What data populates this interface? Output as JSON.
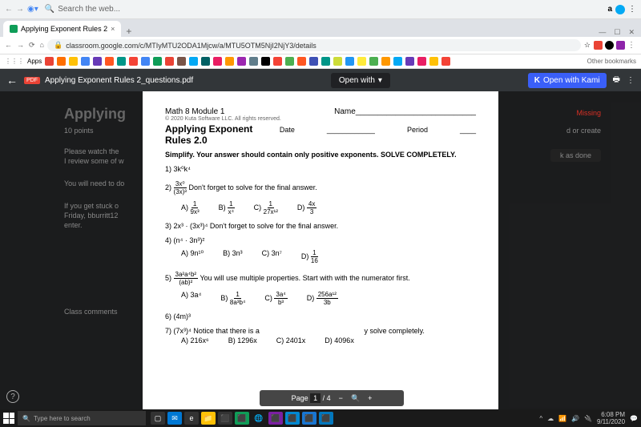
{
  "browser": {
    "search_placeholder": "Search the web...",
    "tab_title": "Applying Exponent Rules 2",
    "url": "classroom.google.com/c/MTIyMTU2ODA1Mjcw/a/MTU5OTM5NjI2NjY3/details",
    "apps_label": "Apps",
    "other_bookmarks": "Other bookmarks"
  },
  "pdf": {
    "filename": "Applying Exponent Rules 2_questions.pdf",
    "open_with": "Open with",
    "kami": "Open with Kami",
    "page_label": "Page",
    "page_current": "1",
    "page_total": "4"
  },
  "doc": {
    "module": "Math 8 Module 1",
    "copyright": "© 2020 Kuta Software LLC. All rights reserved.",
    "title": "Applying Exponent Rules 2.0",
    "name_label": "Name",
    "date_label": "Date",
    "period_label": "Period",
    "instructions": "Simplify. Your answer should contain only positive exponents. SOLVE COMPLETELY.",
    "problems": {
      "p1": "1) 3k⁰k⁴",
      "p2_label": "2)",
      "p2_note": "Don't forget to solve for the final answer.",
      "p2a": "A)",
      "p2b": "B)",
      "p2c": "C)",
      "p2d": "D)",
      "p3": "3) 2x³ · (3x³)⁴ Don't forget to solve for the final answer.",
      "p4": "4) (n⁴ · 3n³)²",
      "p4a": "A) 9n¹⁰",
      "p4b": "B) 3n³",
      "p4c": "C) 3n⁷",
      "p4d": "D)",
      "p5_label": "5)",
      "p5_note": "You will use multiple properties. Start with with the numerator first.",
      "p5a": "A) 3a⁴",
      "p5b": "B)",
      "p5c": "C)",
      "p5d": "D)",
      "p6": "6) (4m)³",
      "p7_label": "7) (7x³)⁴ Notice that there is a",
      "p7_note": "y solve completely.",
      "p7a": "A) 216x⁶",
      "p7b": "B) 1296x",
      "p7c": "C) 2401x",
      "p7d": "D) 4096x"
    }
  },
  "bg": {
    "applying": "Applying",
    "points": "10 points",
    "please": "Please watch the",
    "review": "I review some of w",
    "need": "You will need to do",
    "stuck": "If you get stuck o",
    "friday": "Friday, bburritt12",
    "enter": "enter.",
    "class": "Class comments",
    "missing": "Missing",
    "create": "d or create",
    "done": "k as done"
  },
  "taskbar": {
    "search": "Type here to search",
    "time": "6:08 PM",
    "date": "9/11/2020"
  }
}
